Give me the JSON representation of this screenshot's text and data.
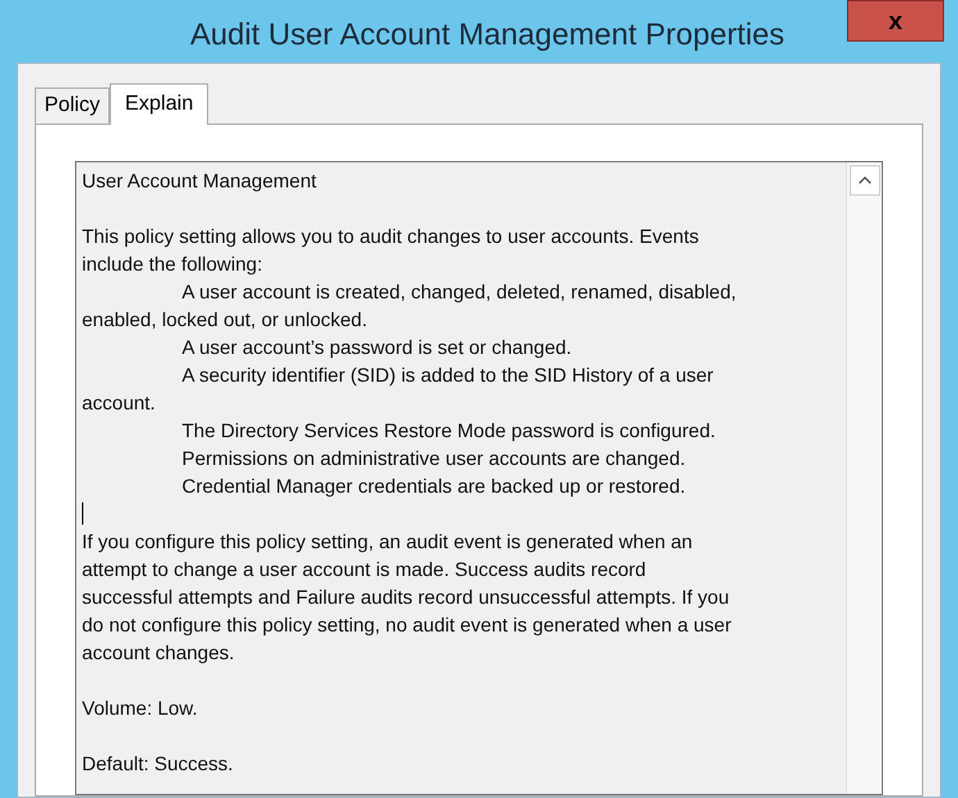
{
  "window": {
    "title": "Audit User Account Management Properties",
    "close_label": "x"
  },
  "tabs": [
    {
      "label": "Policy",
      "selected": false
    },
    {
      "label": "Explain",
      "selected": true
    }
  ],
  "explain_lines": [
    {
      "kind": "text",
      "text": "User Account Management"
    },
    {
      "kind": "blank"
    },
    {
      "kind": "text",
      "text": "This policy setting allows you to audit changes to user accounts. Events"
    },
    {
      "kind": "text",
      "text": "include the following:"
    },
    {
      "kind": "indented",
      "text": "A user account is created, changed, deleted, renamed, disabled,"
    },
    {
      "kind": "text",
      "text": "enabled, locked out, or unlocked."
    },
    {
      "kind": "indented",
      "text": "A user account’s password is set or changed."
    },
    {
      "kind": "indented",
      "text": "A security identifier (SID) is added to the SID History of a user"
    },
    {
      "kind": "text",
      "text": "account."
    },
    {
      "kind": "indented",
      "text": "The Directory Services Restore Mode password is configured."
    },
    {
      "kind": "indented",
      "text": "Permissions on administrative user accounts are changed."
    },
    {
      "kind": "indented",
      "text": "Credential Manager credentials are backed up or restored."
    },
    {
      "kind": "caret"
    },
    {
      "kind": "text",
      "text": "If you configure this policy setting, an audit event is generated when an"
    },
    {
      "kind": "text",
      "text": "attempt to change a user account is made. Success audits record"
    },
    {
      "kind": "text",
      "text": "successful attempts and Failure audits record unsuccessful attempts. If you"
    },
    {
      "kind": "text",
      "text": "do not configure this policy setting, no audit event is generated when a user"
    },
    {
      "kind": "text",
      "text": "account changes."
    },
    {
      "kind": "blank"
    },
    {
      "kind": "text",
      "text": "Volume: Low."
    },
    {
      "kind": "blank"
    },
    {
      "kind": "text",
      "text": "Default: Success."
    }
  ]
}
